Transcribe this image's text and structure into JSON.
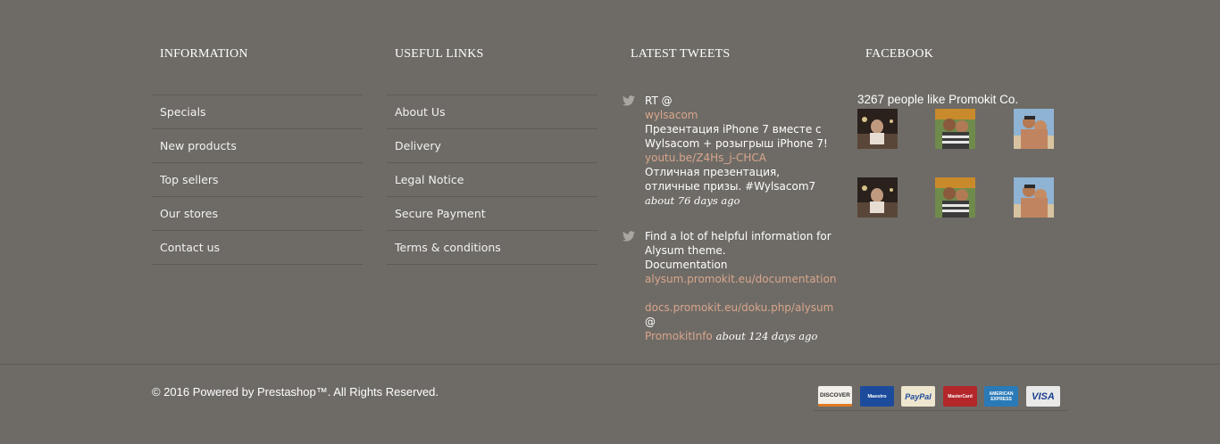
{
  "information": {
    "title": "INFORMATION",
    "items": [
      "Specials",
      "New products",
      "Top sellers",
      "Our stores",
      "Contact us"
    ]
  },
  "useful_links": {
    "title": "USEFUL LINKS",
    "items": [
      "About Us",
      "Delivery",
      "Legal Notice",
      "Secure Payment",
      "Terms & conditions"
    ]
  },
  "tweets": {
    "title": "LATEST TWEETS",
    "items": [
      {
        "prefix": "RT @",
        "handle": "wylsacom",
        "text": "Презентация iPhone 7 вместе с Wylsacom + розыгрыш iPhone 7!",
        "link": "youtu.be/Z4Hs_j-CHCA",
        "text2": "Отличная презентация, отличные призы. #Wylsacom7",
        "time": "about 76 days ago"
      },
      {
        "text": "Find a lot of helpful information for Alysum theme.",
        "text2": "Documentation",
        "link": "alysum.promokit.eu/documentation",
        "link2": "docs.promokit.eu/doku.php/alysum",
        "at": "@",
        "handle": "PromokitInfo",
        "time": "about 124 days ago"
      }
    ]
  },
  "facebook": {
    "title": "FACEBOOK",
    "likes_text": "3267 people like Promokit Co."
  },
  "footer": {
    "copyright": "© 2016 Powered by Prestashop™. All Rights Reserved.",
    "payments": [
      "DISCOVER",
      "Maestro",
      "PayPal",
      "MasterCard",
      "AMERICAN EXPRESS",
      "VISA"
    ]
  },
  "colors": {
    "background": "#6e6b66",
    "link_accent": "#d9a58c",
    "divider": "#5e5b57"
  }
}
